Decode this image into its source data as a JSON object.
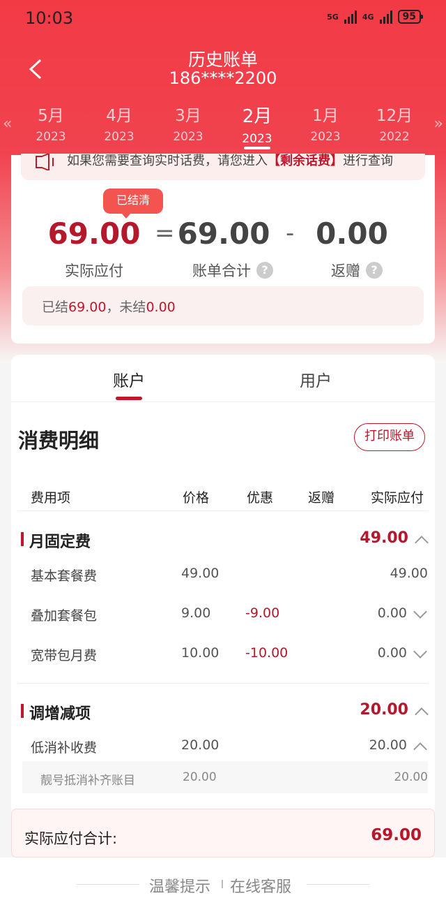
{
  "status": {
    "time": "10:03",
    "net1": "5G",
    "net2": "4G",
    "battery": "95"
  },
  "header": {
    "title": "历史账单",
    "phone": "186****2200"
  },
  "months": [
    {
      "m": "5月",
      "y": "2023"
    },
    {
      "m": "4月",
      "y": "2023"
    },
    {
      "m": "3月",
      "y": "2023"
    },
    {
      "m": "2月",
      "y": "2023",
      "active": true
    },
    {
      "m": "1月",
      "y": "2023"
    },
    {
      "m": "12月",
      "y": "2022"
    }
  ],
  "notice": {
    "pre": "如果您需要查询实时话费，请您进入",
    "link": "【剩余话费】",
    "post": "进行查询"
  },
  "summary": {
    "badge": "已结清",
    "actual": "69.00",
    "actual_label": "实际应付",
    "eq": "=",
    "bill_total": "69.00",
    "bill_label": "账单合计",
    "minus": "-",
    "rebate": "0.00",
    "rebate_label": "返赠",
    "q": "?",
    "settled_label": "已结",
    "settled_value": "69.00",
    "unsettled_label": "，未结",
    "unsettled_value": "0.00"
  },
  "tabs": {
    "account": "账户",
    "user": "用户"
  },
  "detail": {
    "title": "消费明细",
    "print_button": "打印账单",
    "columns": [
      "费用项",
      "价格",
      "优惠",
      "返赠",
      "实际应付"
    ],
    "groups": [
      {
        "name": "月固定费",
        "total": "49.00",
        "rows": [
          {
            "item": "基本套餐费",
            "price": "49.00",
            "discount": "",
            "rebate": "",
            "actual": "49.00"
          },
          {
            "item": "叠加套餐包",
            "price": "9.00",
            "discount": "-9.00",
            "rebate": "",
            "actual": "0.00"
          },
          {
            "item": "宽带包月费",
            "price": "10.00",
            "discount": "-10.00",
            "rebate": "",
            "actual": "0.00"
          }
        ]
      },
      {
        "name": "调增减项",
        "total": "20.00",
        "rows": [
          {
            "item": "低消补收费",
            "price": "20.00",
            "discount": "",
            "rebate": "",
            "actual": "20.00"
          }
        ],
        "sub": {
          "item": "靓号抵消补齐账目",
          "price": "20.00",
          "actual": "20.00"
        }
      }
    ],
    "total_label": "实际应付合计:",
    "total_value": "69.00"
  },
  "footer": {
    "tip": "温馨提示",
    "service": "在线客服"
  },
  "colors": {
    "brand": "#f23a45",
    "accent": "#c0172b"
  }
}
